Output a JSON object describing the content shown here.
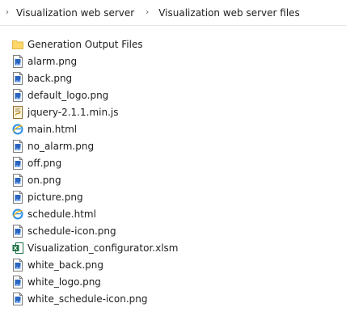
{
  "breadcrumb": {
    "items": [
      {
        "label": "Visualization web server"
      },
      {
        "label": "Visualization web server files"
      }
    ]
  },
  "files": [
    {
      "name": "Generation Output Files",
      "icon": "folder-icon"
    },
    {
      "name": "alarm.png",
      "icon": "image-file-icon"
    },
    {
      "name": "back.png",
      "icon": "image-file-icon"
    },
    {
      "name": "default_logo.png",
      "icon": "image-file-icon"
    },
    {
      "name": "jquery-2.1.1.min.js",
      "icon": "script-file-icon"
    },
    {
      "name": "main.html",
      "icon": "html-file-icon"
    },
    {
      "name": "no_alarm.png",
      "icon": "image-file-icon"
    },
    {
      "name": "off.png",
      "icon": "image-file-icon"
    },
    {
      "name": "on.png",
      "icon": "image-file-icon"
    },
    {
      "name": "picture.png",
      "icon": "image-file-icon"
    },
    {
      "name": "schedule.html",
      "icon": "html-file-icon"
    },
    {
      "name": "schedule-icon.png",
      "icon": "image-file-icon"
    },
    {
      "name": "Visualization_configurator.xlsm",
      "icon": "excel-file-icon"
    },
    {
      "name": "white_back.png",
      "icon": "image-file-icon"
    },
    {
      "name": "white_logo.png",
      "icon": "image-file-icon"
    },
    {
      "name": "white_schedule-icon.png",
      "icon": "image-file-icon"
    }
  ],
  "colors": {
    "folder": "#ffd76b",
    "image_blue": "#2b66c0",
    "excel_green": "#1e7145",
    "ie_blue": "#2d8fe3",
    "ie_gold": "#f2b705"
  }
}
